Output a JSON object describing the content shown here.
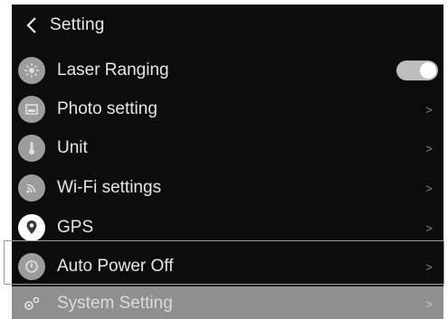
{
  "header": {
    "title": "Setting"
  },
  "items": [
    {
      "label": "Laser Ranging",
      "icon": "laser-icon",
      "control": "toggle",
      "toggle_on": true
    },
    {
      "label": "Photo setting",
      "icon": "photo-icon",
      "control": "chevron",
      "chevron": ">"
    },
    {
      "label": "Unit",
      "icon": "thermometer-icon",
      "control": "chevron",
      "chevron": ">"
    },
    {
      "label": "Wi-Fi settings",
      "icon": "wifi-icon",
      "control": "chevron",
      "chevron": ">"
    },
    {
      "label": "GPS",
      "icon": "location-pin-icon",
      "control": "chevron",
      "chevron": ">"
    },
    {
      "label": "Auto Power Off",
      "icon": "power-icon",
      "control": "chevron",
      "chevron": ">"
    },
    {
      "label": "System Setting",
      "icon": "gear-icon",
      "control": "chevron",
      "chevron": ">"
    }
  ],
  "colors": {
    "screen_bg": "#0c0c0c",
    "icon_bg": "#9c9c9c",
    "toggle_on": "#bdbdbd",
    "system_row_bg": "#8f8f8f",
    "highlight_outline": "#9a9a9a"
  }
}
